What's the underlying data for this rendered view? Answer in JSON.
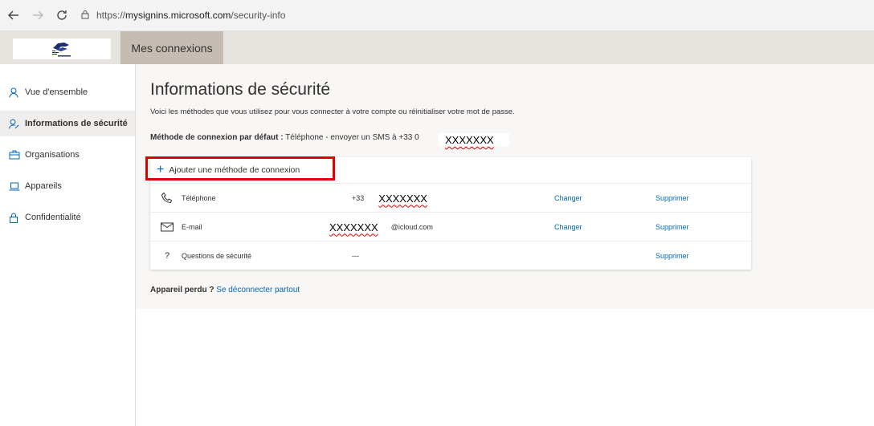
{
  "browser": {
    "url_prefix": "https://",
    "url_host": "mysignins.microsoft.com",
    "url_path": "/security-info"
  },
  "header": {
    "app_title": "Mes connexions"
  },
  "sidebar": {
    "items": [
      {
        "label": "Vue d'ensemble",
        "icon": "person-icon",
        "active": false
      },
      {
        "label": "Informations de sécurité",
        "icon": "key-person-icon",
        "active": true
      },
      {
        "label": "Organisations",
        "icon": "briefcase-icon",
        "active": false
      },
      {
        "label": "Appareils",
        "icon": "laptop-icon",
        "active": false
      },
      {
        "label": "Confidentialité",
        "icon": "lock-icon",
        "active": false
      }
    ]
  },
  "main": {
    "title": "Informations de sécurité",
    "description": "Voici les méthodes que vous utilisez pour vous connecter à votre compte ou réinitialiser votre mot de passe.",
    "default_method_label": "Méthode de connexion par défaut :",
    "default_method_value": " Téléphone - envoyer un SMS à +33 0",
    "default_method_redacted": "XXXXXXX",
    "add_method_label": "Ajouter une méthode de connexion",
    "methods": [
      {
        "name": "Téléphone",
        "prefix": "+33",
        "redacted": "XXXXXXX",
        "suffix": "",
        "change": "Changer",
        "delete": "Supprimer"
      },
      {
        "name": "E-mail",
        "prefix": "",
        "redacted": "XXXXXXX",
        "suffix": "@icloud.com",
        "change": "Changer",
        "delete": "Supprimer"
      },
      {
        "name": "Questions de sécurité",
        "prefix": "---",
        "redacted": "",
        "suffix": "",
        "change": "",
        "delete": "Supprimer"
      }
    ],
    "lost_device_label": "Appareil perdu ?",
    "lost_device_link": "Se déconnecter partout"
  },
  "colors": {
    "accent": "#0067b8",
    "highlight": "#e00000",
    "header_bg": "#e6e2dd",
    "title_tab_bg": "#c5bdb3"
  }
}
